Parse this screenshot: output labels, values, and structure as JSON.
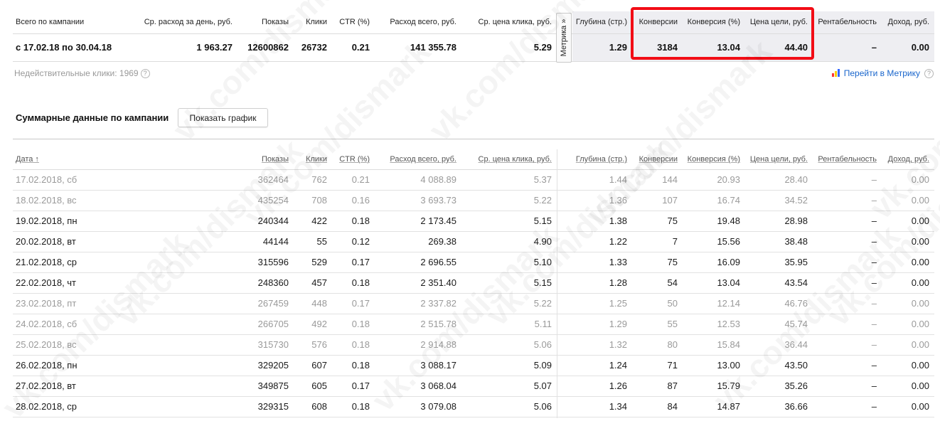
{
  "summary": {
    "headers": [
      "Всего по кампании",
      "Ср. расход за день, руб.",
      "Показы",
      "Клики",
      "CTR (%)",
      "Расход всего, руб.",
      "Ср. цена клика, руб.",
      "Глубина (стр.)",
      "Конверсии",
      "Конверсия (%)",
      "Цена цели, руб.",
      "Рентабельность",
      "Доход, руб."
    ],
    "row": [
      "с 17.02.18 по 30.04.18",
      "1 963.27",
      "12600862",
      "26732",
      "0.21",
      "141 355.78",
      "5.29",
      "1.29",
      "3184",
      "13.04",
      "44.40",
      "–",
      "0.00"
    ]
  },
  "metrika_tab": "Метрика »",
  "invalid_clicks": "Недействительные клики: 1969",
  "help_glyph": "?",
  "metrika_link": "Перейти в Метрику",
  "section_title": "Суммарные данные по кампании",
  "show_chart_button": "Показать график",
  "detail": {
    "headers": [
      "Дата ↑",
      "Показы",
      "Клики",
      "CTR (%)",
      "Расход всего, руб.",
      "Ср. цена клика, руб.",
      "Глубина (стр.)",
      "Конверсии",
      "Конверсия (%)",
      "Цена цели, руб.",
      "Рентабельность",
      "Доход, руб."
    ],
    "rows": [
      {
        "weekend": true,
        "cells": [
          "17.02.2018, сб",
          "362464",
          "762",
          "0.21",
          "4 088.89",
          "5.37",
          "1.44",
          "144",
          "20.93",
          "28.40",
          "–",
          "0.00"
        ]
      },
      {
        "weekend": true,
        "cells": [
          "18.02.2018, вс",
          "435254",
          "708",
          "0.16",
          "3 693.73",
          "5.22",
          "1.36",
          "107",
          "16.74",
          "34.52",
          "–",
          "0.00"
        ]
      },
      {
        "weekend": false,
        "cells": [
          "19.02.2018, пн",
          "240344",
          "422",
          "0.18",
          "2 173.45",
          "5.15",
          "1.38",
          "75",
          "19.48",
          "28.98",
          "–",
          "0.00"
        ]
      },
      {
        "weekend": false,
        "cells": [
          "20.02.2018, вт",
          "44144",
          "55",
          "0.12",
          "269.38",
          "4.90",
          "1.22",
          "7",
          "15.56",
          "38.48",
          "–",
          "0.00"
        ]
      },
      {
        "weekend": false,
        "cells": [
          "21.02.2018, ср",
          "315596",
          "529",
          "0.17",
          "2 696.55",
          "5.10",
          "1.33",
          "75",
          "16.09",
          "35.95",
          "–",
          "0.00"
        ]
      },
      {
        "weekend": false,
        "cells": [
          "22.02.2018, чт",
          "248360",
          "457",
          "0.18",
          "2 351.40",
          "5.15",
          "1.28",
          "54",
          "13.04",
          "43.54",
          "–",
          "0.00"
        ]
      },
      {
        "weekend": true,
        "cells": [
          "23.02.2018, пт",
          "267459",
          "448",
          "0.17",
          "2 337.82",
          "5.22",
          "1.25",
          "50",
          "12.14",
          "46.76",
          "–",
          "0.00"
        ]
      },
      {
        "weekend": true,
        "cells": [
          "24.02.2018, сб",
          "266705",
          "492",
          "0.18",
          "2 515.78",
          "5.11",
          "1.29",
          "55",
          "12.53",
          "45.74",
          "–",
          "0.00"
        ]
      },
      {
        "weekend": true,
        "cells": [
          "25.02.2018, вс",
          "315730",
          "576",
          "0.18",
          "2 914.88",
          "5.06",
          "1.32",
          "80",
          "15.84",
          "36.44",
          "–",
          "0.00"
        ]
      },
      {
        "weekend": false,
        "cells": [
          "26.02.2018, пн",
          "329205",
          "607",
          "0.18",
          "3 088.17",
          "5.09",
          "1.24",
          "71",
          "13.00",
          "43.50",
          "–",
          "0.00"
        ]
      },
      {
        "weekend": false,
        "cells": [
          "27.02.2018, вт",
          "349875",
          "605",
          "0.17",
          "3 068.04",
          "5.07",
          "1.26",
          "87",
          "15.79",
          "35.26",
          "–",
          "0.00"
        ]
      },
      {
        "weekend": false,
        "cells": [
          "28.02.2018, ср",
          "329315",
          "608",
          "0.18",
          "3 079.08",
          "5.06",
          "1.34",
          "84",
          "14.87",
          "36.66",
          "–",
          "0.00"
        ]
      }
    ]
  },
  "watermark": "vk.com/dismark",
  "colors": {
    "highlight": "#f20d16",
    "link": "#1a66cc",
    "metrika_shade": "#eeeef2"
  }
}
